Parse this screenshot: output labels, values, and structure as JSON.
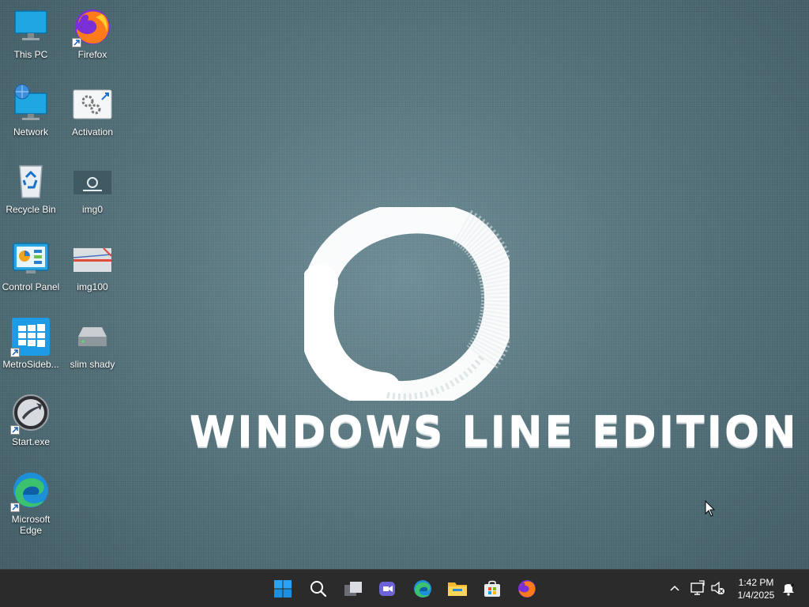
{
  "desktop": {
    "icons": [
      {
        "label": "This PC",
        "icon": "monitor-icon"
      },
      {
        "label": "Firefox",
        "icon": "firefox-icon"
      },
      {
        "label": "Network",
        "icon": "network-icon"
      },
      {
        "label": "Activation",
        "icon": "activation-icon"
      },
      {
        "label": "Recycle Bin",
        "icon": "recycle-bin-icon"
      },
      {
        "label": "img0",
        "icon": "image-icon"
      },
      {
        "label": "Control Panel",
        "icon": "control-panel-icon"
      },
      {
        "label": "img100",
        "icon": "image-icon"
      },
      {
        "label": "MetroSideb...",
        "icon": "windows-tiles-icon"
      },
      {
        "label": "slim shady",
        "icon": "drive-icon"
      },
      {
        "label": "Start.exe",
        "icon": "start-orb-icon"
      },
      {
        "label": "Microsoft Edge",
        "icon": "edge-icon"
      }
    ]
  },
  "wallpaper": {
    "title": "WINDOWS LINE EDITION"
  },
  "taskbar": {
    "apps": [
      {
        "name": "Start",
        "icon": "windows-logo-icon"
      },
      {
        "name": "Search",
        "icon": "search-icon"
      },
      {
        "name": "Task View",
        "icon": "task-view-icon"
      },
      {
        "name": "Teams",
        "icon": "teams-icon"
      },
      {
        "name": "Microsoft Edge",
        "icon": "edge-icon"
      },
      {
        "name": "File Explorer",
        "icon": "folder-icon"
      },
      {
        "name": "Microsoft Store",
        "icon": "store-icon"
      },
      {
        "name": "Firefox",
        "icon": "firefox-icon"
      }
    ],
    "tray": {
      "time": "1:42 PM",
      "date": "1/4/2025"
    }
  },
  "colors": {
    "taskbar": "#2b2b2b",
    "accent": "#0078d4",
    "wallpaper": "#56737c"
  }
}
